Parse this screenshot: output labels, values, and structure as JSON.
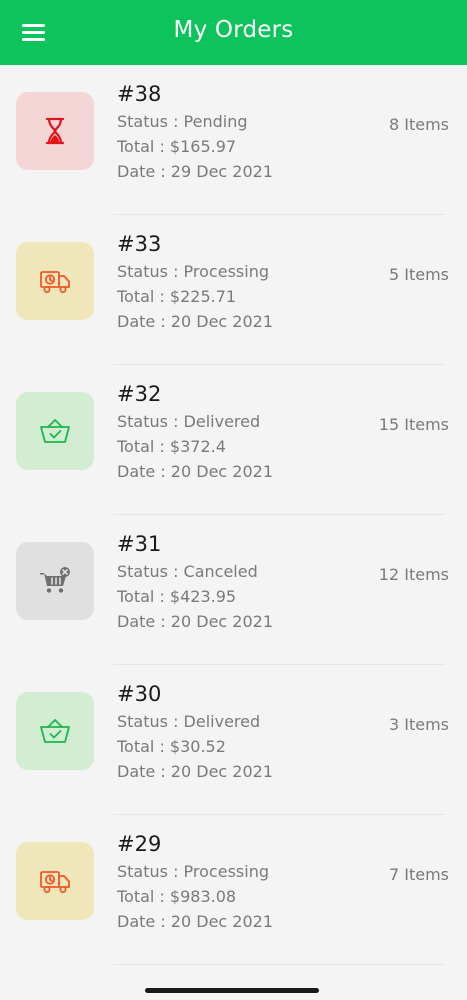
{
  "header": {
    "title": "My Orders",
    "menu_icon": "hamburger-menu-icon"
  },
  "colors": {
    "header_bg": "#0cc45b",
    "background": "#f4f4f4"
  },
  "orders": [
    {
      "number": "#38",
      "status": "Status : Pending",
      "total": "Total : $165.97",
      "date": "Date : 29 Dec 2021",
      "items": "8 Items",
      "icon": "hourglass-icon",
      "icon_bg": "#f5d6d6",
      "icon_color": "#e0161b"
    },
    {
      "number": "#33",
      "status": "Status : Processing",
      "total": "Total : $225.71",
      "date": "Date : 20 Dec 2021",
      "items": "5 Items",
      "icon": "delivery-truck-icon",
      "icon_bg": "#efe6b9",
      "icon_color": "#f0592a"
    },
    {
      "number": "#32",
      "status": "Status : Delivered",
      "total": "Total : $372.4",
      "date": "Date : 20 Dec 2021",
      "items": "15 Items",
      "icon": "basket-check-icon",
      "icon_bg": "#d2edd2",
      "icon_color": "#19b84e"
    },
    {
      "number": "#31",
      "status": "Status : Canceled",
      "total": "Total : $423.95",
      "date": "Date : 20 Dec 2021",
      "items": "12 Items",
      "icon": "cart-cancel-icon",
      "icon_bg": "#e0e0e0",
      "icon_color": "#6f6f6f"
    },
    {
      "number": "#30",
      "status": "Status : Delivered",
      "total": "Total : $30.52",
      "date": "Date : 20 Dec 2021",
      "items": "3 Items",
      "icon": "basket-check-icon",
      "icon_bg": "#d2edd2",
      "icon_color": "#19b84e"
    },
    {
      "number": "#29",
      "status": "Status : Processing",
      "total": "Total : $983.08",
      "date": "Date : 20 Dec 2021",
      "items": "7 Items",
      "icon": "delivery-truck-icon",
      "icon_bg": "#efe6b9",
      "icon_color": "#f0592a"
    }
  ]
}
